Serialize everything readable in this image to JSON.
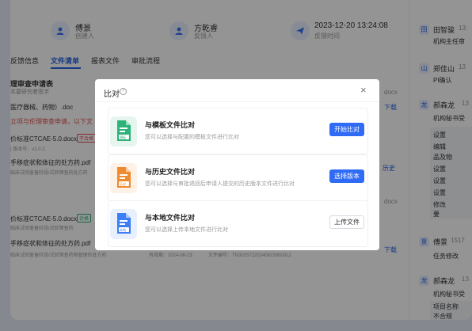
{
  "header": {
    "user1": {
      "name": "傅景",
      "role": "创建人"
    },
    "user2": {
      "name": "方乾睿",
      "role": "反馈人"
    },
    "time": {
      "value": "2023-12-20 13:24:08",
      "label": "反馈时间"
    }
  },
  "tabs": [
    {
      "label": "反馈信息"
    },
    {
      "label": "文件清单"
    },
    {
      "label": "报表文件"
    },
    {
      "label": "审批流程"
    }
  ],
  "main": {
    "section_title": "理审查申请表",
    "section_sub": "本要研究者签字",
    "line1": "医疗器械、药物）.doc",
    "ext1": "docx",
    "download1": "下载",
    "warn_line": "立项与伦理审查申请，以下文",
    "file_a": "价标准CTCAE-5.0.docx",
    "badge_a": "不合格",
    "file_a_meta1": "|",
    "file_a_meta2": "版本号：v1.0.2",
    "file_a_meta3": "版本",
    "file_b": "手移症状和体征的处方药.pdf",
    "file_b_meta": "临床试验鉴备阶段/试验筛查的处方药",
    "history1": "历史",
    "ext_mid": "docx",
    "file_c": "价标准CTCAE-5.0.docx",
    "badge_c": "合格",
    "file_c_meta": "临床试验鉴备阶段/试验筛查的",
    "file_d": "手移症状和体征的处方药.pdf",
    "file_d_meta": "临床试验鉴备阶段/试验筛查药物管理的处方药",
    "valid": "有效期：2024-06-23",
    "file_no": "文件编号：TN30257220240615000012",
    "download2": "下载"
  },
  "right": {
    "e1": {
      "avatar": "田",
      "name": "田智骏",
      "time": "13:",
      "sub": "机构主任审"
    },
    "e2": {
      "avatar": "山",
      "name": "郑佳山",
      "time": "13",
      "sub": "PI确认"
    },
    "e3": {
      "avatar": "龙",
      "name": "郝森龙",
      "time": "13",
      "sub": "机构秘书受"
    },
    "settings": [
      "设置",
      "编辑",
      "品及物",
      "设置",
      "设置",
      "设置",
      "修改",
      "要"
    ],
    "e4": {
      "avatar": "景",
      "name": "傅景",
      "time": "1517",
      "sub": "任务修改"
    },
    "e5": {
      "avatar": "龙",
      "name": "郝森龙",
      "time": "13",
      "sub": "机构秘书受"
    },
    "list": [
      "项目名称",
      "不合规"
    ]
  },
  "dialog": {
    "title": "比对",
    "help_icon": "question-icon",
    "close_icon": "close-icon",
    "options": [
      {
        "title": "与模板文件比对",
        "desc": "您可以选择与配置的模板文件进行比对",
        "button": "开始比对",
        "icon_label": "模板",
        "color": "#2db27a",
        "primary": true
      },
      {
        "title": "与历史文件比对",
        "desc": "您可以选择与审批退回后申请人提交的历史版本文件进行比对",
        "button": "选择版本",
        "icon_label": "历史",
        "color": "#f08a2e",
        "primary": true
      },
      {
        "title": "与本地文件比对",
        "desc": "您可以选择上传本地文件进行比对",
        "button": "上传文件",
        "icon_label": "本地",
        "color": "#3b7ef5",
        "primary": false
      }
    ]
  }
}
